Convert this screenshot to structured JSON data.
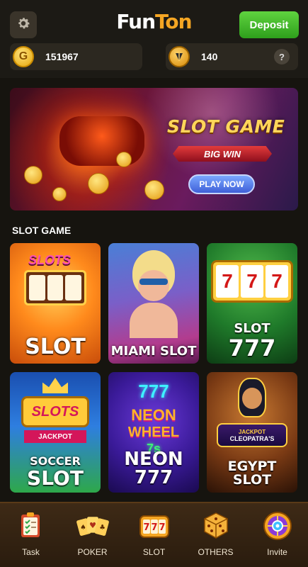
{
  "header": {
    "logo_fun": "Fun",
    "logo_ton": "Ton",
    "deposit_label": "Deposit"
  },
  "balances": {
    "gold": {
      "icon": "gold-coin-icon",
      "value": "151967"
    },
    "ton": {
      "icon": "ton-coin-icon",
      "value": "140",
      "help": "?"
    }
  },
  "banner": {
    "title": "SLOT GAME",
    "ribbon": "BIG WIN",
    "play_label": "PLAY NOW"
  },
  "section": {
    "title": "SLOT GAME"
  },
  "games": [
    {
      "label": "SLOT",
      "theme": "slots"
    },
    {
      "label": "MIAMI SLOT",
      "theme": "miami"
    },
    {
      "label": "SLOT\n777",
      "line1": "SLOT",
      "line2": "777",
      "theme": "777"
    },
    {
      "label": "SOCCER SLOT",
      "line1": "SOCCER",
      "line2": "SLOT",
      "theme": "soccer"
    },
    {
      "label": "NEON 777",
      "theme": "neon"
    },
    {
      "label": "EGYPT SLOT",
      "theme": "egypt"
    }
  ],
  "nav": [
    {
      "label": "Task",
      "icon": "task-icon"
    },
    {
      "label": "POKER",
      "icon": "poker-cards-icon"
    },
    {
      "label": "SLOT",
      "icon": "slot-777-icon"
    },
    {
      "label": "OTHERS",
      "icon": "dice-icon"
    },
    {
      "label": "Invite",
      "icon": "invite-wheel-icon"
    }
  ],
  "colors": {
    "accent_green": "#3bb52a",
    "logo_orange": "#f5a623",
    "background": "#16140f",
    "nav_bg": "#3e2a16"
  }
}
